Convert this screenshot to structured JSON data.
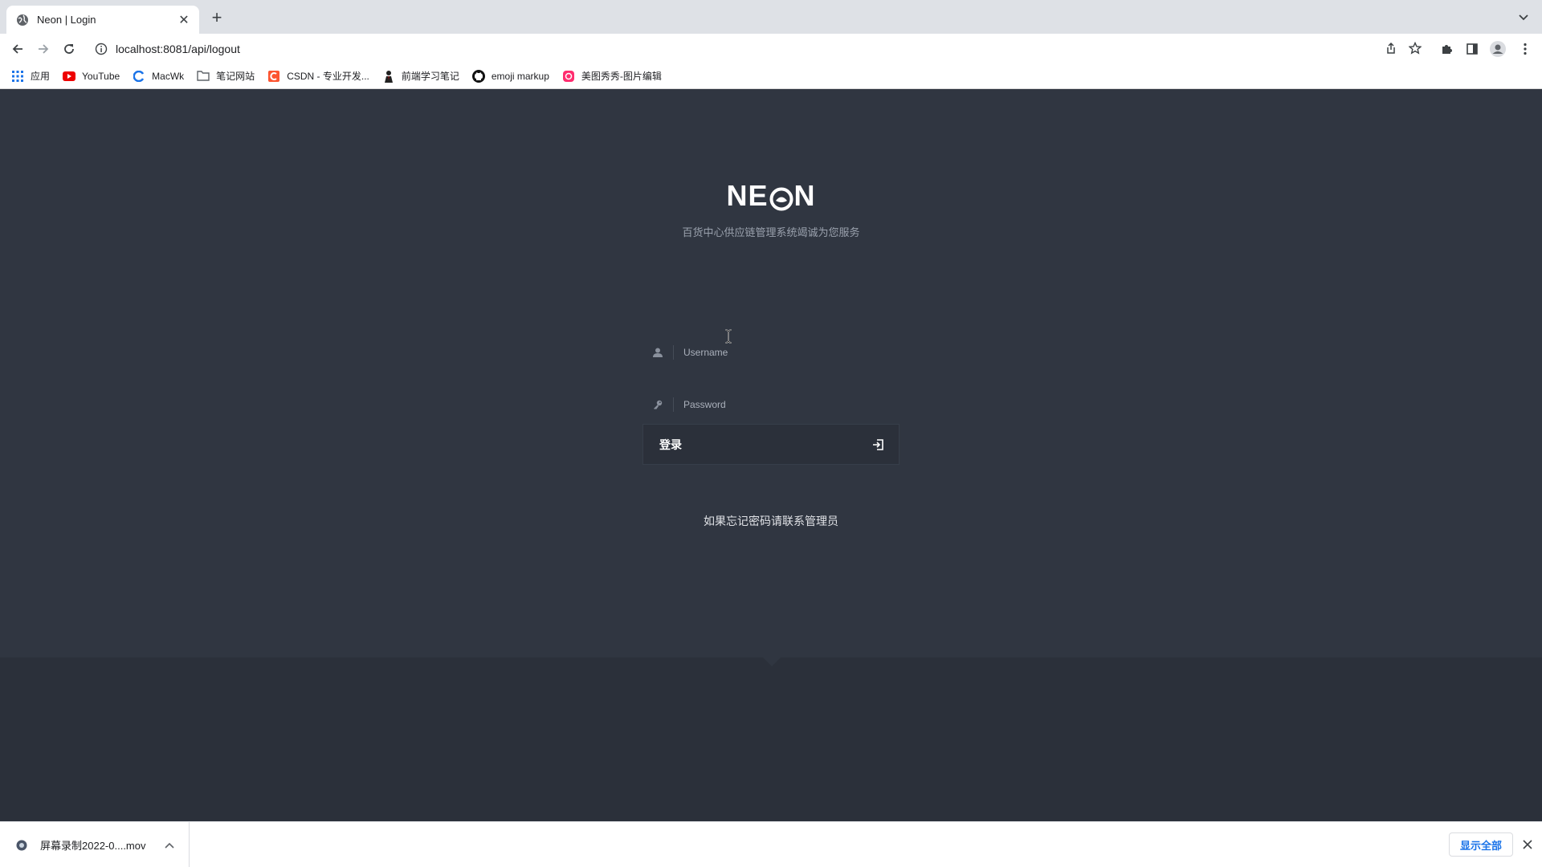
{
  "browser": {
    "tab": {
      "title": "Neon | Login",
      "icon": "globe-icon"
    },
    "address": "localhost:8081/api/logout",
    "bookmarks": [
      {
        "label": "应用",
        "icon": "apps-grid-icon"
      },
      {
        "label": "YouTube",
        "icon": "youtube-icon"
      },
      {
        "label": "MacWk",
        "icon": "macwk-icon"
      },
      {
        "label": "笔记网站",
        "icon": "folder-icon"
      },
      {
        "label": "CSDN - 专业开发...",
        "icon": "csdn-icon"
      },
      {
        "label": "前端学习笔记",
        "icon": "person-icon"
      },
      {
        "label": "emoji markup",
        "icon": "github-icon"
      },
      {
        "label": "美图秀秀-图片编辑",
        "icon": "meitu-icon"
      }
    ]
  },
  "login": {
    "logo": "NE",
    "logo_tail": "N",
    "subtitle": "百货中心供应链管理系统竭诚为您服务",
    "username_placeholder": "Username",
    "password_placeholder": "Password",
    "submit_label": "登录",
    "forgot_text": "如果忘记密码请联系管理员"
  },
  "downloads": {
    "file_name": "屏幕录制2022-0....mov",
    "show_all": "显示全部"
  },
  "colors": {
    "page_bg": "#303641",
    "page_lower_bg": "#2b303a",
    "accent_link": "#1a73e8"
  }
}
